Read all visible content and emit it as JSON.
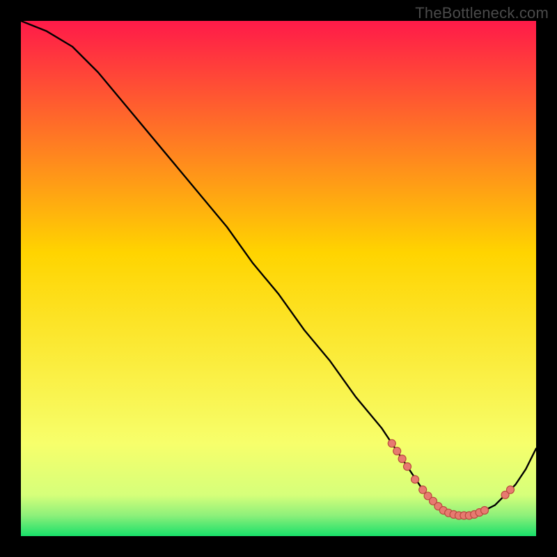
{
  "watermark": "TheBottleneck.com",
  "colors": {
    "gradient_top": "#ff1a49",
    "gradient_mid": "#ffd400",
    "gradient_low": "#f7ff6b",
    "gradient_bottom": "#18e06a",
    "curve": "#000000",
    "marker_fill": "#e77a70",
    "marker_stroke": "#b94a3f"
  },
  "chart_data": {
    "type": "line",
    "title": "",
    "xlabel": "",
    "ylabel": "",
    "xlim": [
      0,
      100
    ],
    "ylim": [
      0,
      100
    ],
    "grid": false,
    "series": [
      {
        "name": "curve",
        "x": [
          0,
          5,
          10,
          15,
          20,
          25,
          30,
          35,
          40,
          45,
          50,
          55,
          60,
          65,
          70,
          72,
          74,
          76,
          78,
          80,
          82,
          84,
          86,
          88,
          90,
          92,
          94,
          96,
          98,
          100
        ],
        "y": [
          100,
          98,
          95,
          90,
          84,
          78,
          72,
          66,
          60,
          53,
          47,
          40,
          34,
          27,
          21,
          18,
          15,
          12,
          9,
          7,
          5,
          4,
          4,
          4,
          5,
          6,
          8,
          10,
          13,
          17
        ]
      }
    ],
    "markers": [
      {
        "x": 72,
        "y": 18
      },
      {
        "x": 73,
        "y": 16.5
      },
      {
        "x": 74,
        "y": 15
      },
      {
        "x": 75,
        "y": 13.5
      },
      {
        "x": 76.5,
        "y": 11
      },
      {
        "x": 78,
        "y": 9
      },
      {
        "x": 79,
        "y": 7.8
      },
      {
        "x": 80,
        "y": 6.8
      },
      {
        "x": 81,
        "y": 5.8
      },
      {
        "x": 82,
        "y": 5
      },
      {
        "x": 83,
        "y": 4.5
      },
      {
        "x": 84,
        "y": 4.2
      },
      {
        "x": 85,
        "y": 4
      },
      {
        "x": 86,
        "y": 4
      },
      {
        "x": 87,
        "y": 4
      },
      {
        "x": 88,
        "y": 4.2
      },
      {
        "x": 89,
        "y": 4.6
      },
      {
        "x": 90,
        "y": 5
      },
      {
        "x": 94,
        "y": 8
      },
      {
        "x": 95,
        "y": 9
      }
    ]
  }
}
